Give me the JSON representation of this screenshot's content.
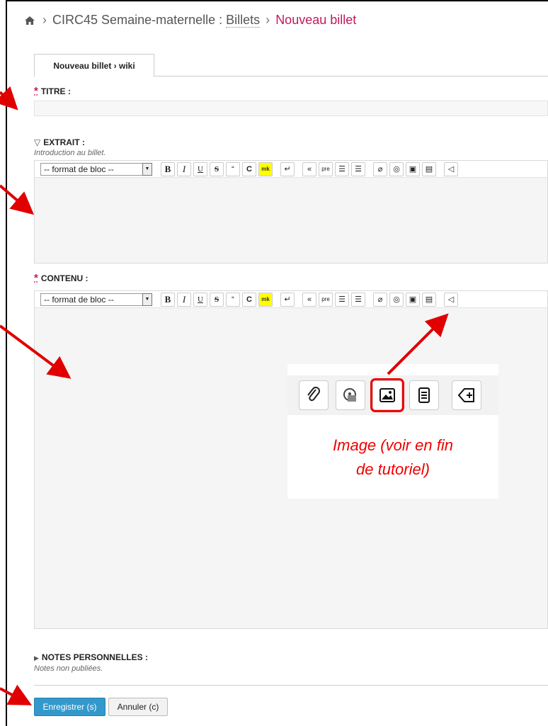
{
  "breadcrumb": {
    "home_icon": "home-icon",
    "part1": "CIRC45 Semaine-maternelle : ",
    "part2": "Billets",
    "current": "Nouveau billet"
  },
  "tab": {
    "label": "Nouveau billet › wiki"
  },
  "fields": {
    "titre": {
      "label": "TITRE :",
      "required_mark": "*"
    },
    "extrait": {
      "toggle": "▽",
      "label": "EXTRAIT :",
      "hint": "Introduction au billet."
    },
    "contenu": {
      "label": "CONTENU :",
      "required_mark": "*"
    },
    "notes": {
      "toggle": "▶",
      "label": "NOTES PERSONNELLES :",
      "hint": "Notes non publiées."
    }
  },
  "toolbar": {
    "format_select": "-- format de bloc --",
    "buttons": {
      "bold": "B",
      "italic": "I",
      "underline": "U",
      "strike": "S",
      "quote": "“",
      "code": "C",
      "mark": "mk",
      "newline": "↵",
      "blockquote": "«",
      "pre": "pre",
      "ul": "☰",
      "ol": "☰",
      "link": "⌀",
      "media": "◎",
      "image": "▣",
      "doc": "▤",
      "tag": "◁"
    }
  },
  "callout": {
    "caption_line1": "Image (voir en fin",
    "caption_line2": "de tutoriel)"
  },
  "actions": {
    "save": "Enregistrer (s)",
    "cancel": "Annuler (c)"
  },
  "colors": {
    "accent": "#c2185b",
    "primary_button": "#3399cc",
    "arrow": "#e00000"
  }
}
